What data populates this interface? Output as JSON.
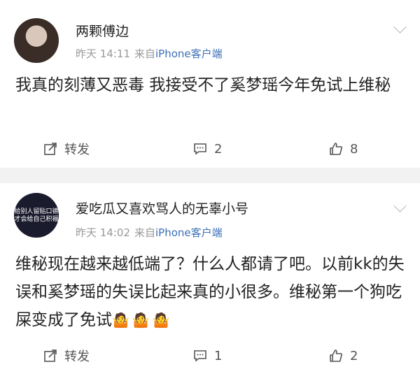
{
  "posts": [
    {
      "username": "两颗傅边",
      "time": "昨天 14:11",
      "from_label": "来自",
      "client": "iPhone客户端",
      "text": "我真的刻薄又恶毒 我接受不了奚梦瑶今年免试上维秘",
      "emoji": "",
      "repost_label": "转发",
      "comments": "2",
      "likes": "8"
    },
    {
      "username": "爱吃瓜又喜欢骂人的无辜小号",
      "time": "昨天 14:02",
      "from_label": "来自",
      "client": "iPhone客户端",
      "text": "维秘现在越来越低端了？什么人都请了吧。以前kk的失误和奚梦瑶的失误比起来真的小很多。维秘第一个狗吃屎变成了免试",
      "emoji": "🤷🤷🤷",
      "repost_label": "转发",
      "comments": "1",
      "likes": "2",
      "avatar_text": [
        "给别人留贴口德",
        "才会给自己积福"
      ]
    }
  ]
}
